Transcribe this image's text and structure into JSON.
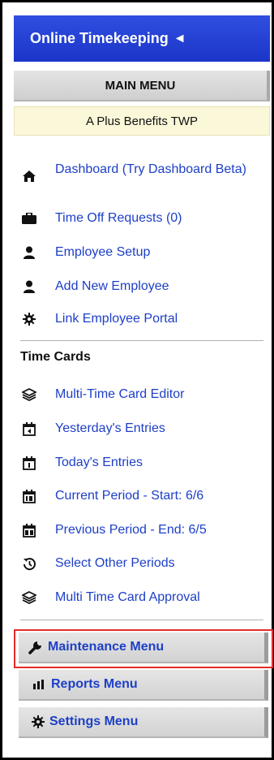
{
  "header": {
    "title": "Online Timekeeping",
    "collapse_glyph": "◄"
  },
  "main_menu": {
    "title": "MAIN MENU",
    "company": "A Plus Benefits TWP"
  },
  "nav": [
    {
      "label": "Dashboard (Try Dashboard Beta)",
      "icon": "home-icon"
    },
    {
      "label": "Time Off Requests (0)",
      "icon": "briefcase-icon"
    },
    {
      "label": "Employee Setup",
      "icon": "user-icon"
    },
    {
      "label": "Add New Employee",
      "icon": "user-icon"
    },
    {
      "label": "Link Employee Portal",
      "icon": "gear-icon"
    }
  ],
  "time_cards": {
    "heading": "Time Cards",
    "items": [
      {
        "label": "Multi-Time Card Editor",
        "icon": "layers-icon"
      },
      {
        "label": "Yesterday's Entries",
        "icon": "calendar-back-icon"
      },
      {
        "label": "Today's Entries",
        "icon": "calendar-today-icon"
      },
      {
        "label": "Current Period - Start: 6/6",
        "icon": "calendar-14-icon"
      },
      {
        "label": "Previous Period - End: 6/5",
        "icon": "calendar-30-icon"
      },
      {
        "label": "Select Other Periods",
        "icon": "history-icon"
      },
      {
        "label": "Multi Time Card Approval",
        "icon": "layers-icon"
      }
    ]
  },
  "menus": {
    "maintenance": "Maintenance Menu",
    "reports": "Reports Menu",
    "settings": "Settings Menu"
  },
  "colors": {
    "title_bar": "#1c35c9",
    "link": "#1d3fc7",
    "company_bg": "#fbf8d9",
    "highlight": "#e32b2b"
  }
}
